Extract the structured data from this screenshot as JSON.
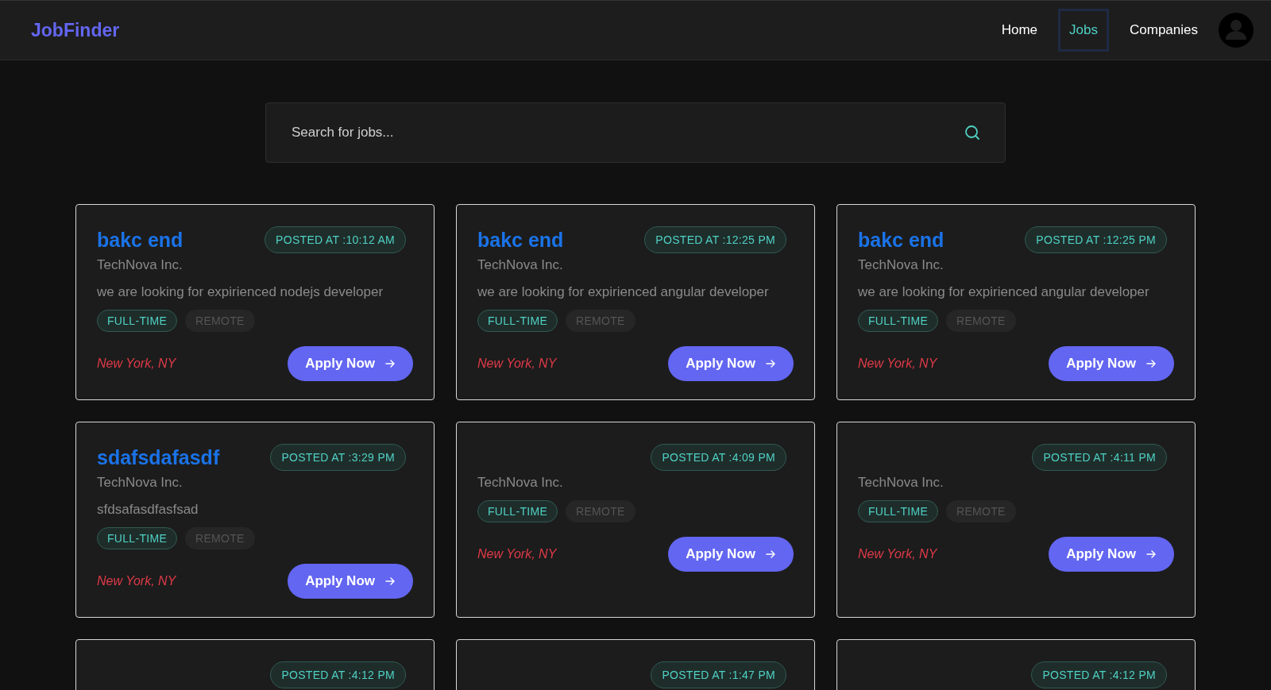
{
  "brand": "JobFinder",
  "nav": [
    {
      "label": "Home",
      "selected": false
    },
    {
      "label": "Jobs",
      "selected": true
    },
    {
      "label": "Companies",
      "selected": false
    }
  ],
  "search": {
    "placeholder": "Search for jobs..."
  },
  "jobs": [
    {
      "title": "bakc end",
      "posted": "POSTED AT :10:12 AM",
      "company": "TechNova Inc.",
      "description": "we are looking for expirienced nodejs developer",
      "tags": [
        {
          "label": "FULL-TIME",
          "on": true
        },
        {
          "label": "REMOTE",
          "on": false
        }
      ],
      "location": "New York, NY",
      "action": "Apply Now"
    },
    {
      "title": "bakc end",
      "posted": "POSTED AT :12:25 PM",
      "company": "TechNova Inc.",
      "description": "we are looking for expirienced angular developer",
      "tags": [
        {
          "label": "FULL-TIME",
          "on": true
        },
        {
          "label": "REMOTE",
          "on": false
        }
      ],
      "location": "New York, NY",
      "action": "Apply Now"
    },
    {
      "title": "bakc end",
      "posted": "POSTED AT :12:25 PM",
      "company": "TechNova Inc.",
      "description": "we are looking for expirienced angular developer",
      "tags": [
        {
          "label": "FULL-TIME",
          "on": true
        },
        {
          "label": "REMOTE",
          "on": false
        }
      ],
      "location": "New York, NY",
      "action": "Apply Now"
    },
    {
      "title": "sdafsdafasdf",
      "posted": "POSTED AT :3:29 PM",
      "company": "TechNova Inc.",
      "description": "sfdsafasdfasfsad",
      "tags": [
        {
          "label": "FULL-TIME",
          "on": true
        },
        {
          "label": "REMOTE",
          "on": false
        }
      ],
      "location": "New York, NY",
      "action": "Apply Now"
    },
    {
      "posted": "POSTED AT :4:09 PM",
      "company": "TechNova Inc.",
      "tags": [
        {
          "label": "FULL-TIME",
          "on": true
        },
        {
          "label": "REMOTE",
          "on": false
        }
      ],
      "location": "New York, NY",
      "action": "Apply Now"
    },
    {
      "posted": "POSTED AT :4:11 PM",
      "company": "TechNova Inc.",
      "tags": [
        {
          "label": "FULL-TIME",
          "on": true
        },
        {
          "label": "REMOTE",
          "on": false
        }
      ],
      "location": "New York, NY",
      "action": "Apply Now"
    },
    {
      "posted": "POSTED AT :4:12 PM"
    },
    {
      "posted": "POSTED AT :1:47 PM"
    },
    {
      "posted": "POSTED AT :4:12 PM"
    }
  ]
}
